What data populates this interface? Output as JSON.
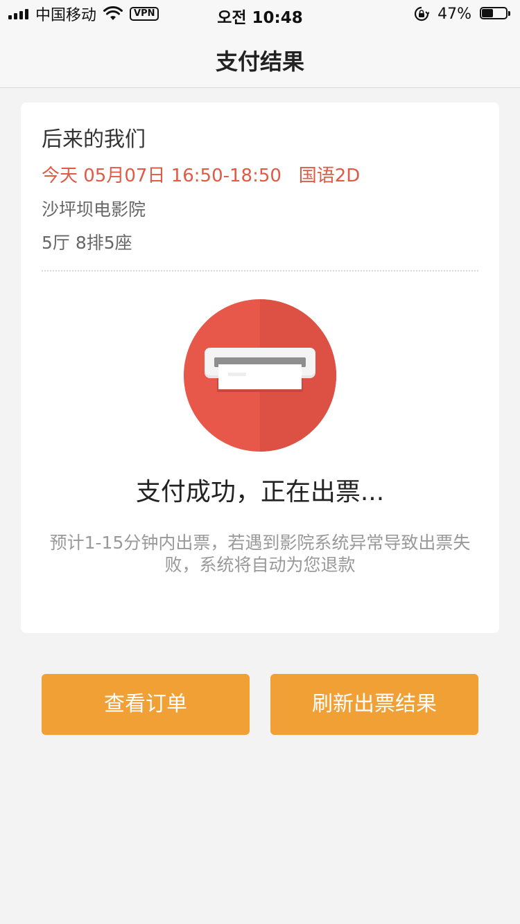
{
  "status_bar": {
    "carrier": "中国移动",
    "vpn": "VPN",
    "time": "오전 10:48",
    "battery_percent": "47%",
    "battery_level": 0.47
  },
  "nav": {
    "title": "支付结果"
  },
  "order": {
    "movie_title": "后来的我们",
    "showtime": "今天 05月07日 16:50-18:50   国语2D",
    "cinema": "沙坪坝电影院",
    "seat": "5厅 8排5座"
  },
  "ticket_status": {
    "title": "支付成功，正在出票...",
    "description": "预计1-15分钟内出票，若遇到影院系统异常导致出票失败，系统将自动为您退款"
  },
  "buttons": {
    "view_orders": "查看订单",
    "refresh_result": "刷新出票结果"
  },
  "colors": {
    "accent_orange": "#f0a035",
    "highlight_red": "#e05a44",
    "icon_red": "#e8584a"
  },
  "icons": {
    "wifi": "wifi-icon",
    "rotation_lock": "rotation-lock-icon",
    "battery": "battery-icon",
    "ticket_printer": "ticket-printer-icon"
  }
}
